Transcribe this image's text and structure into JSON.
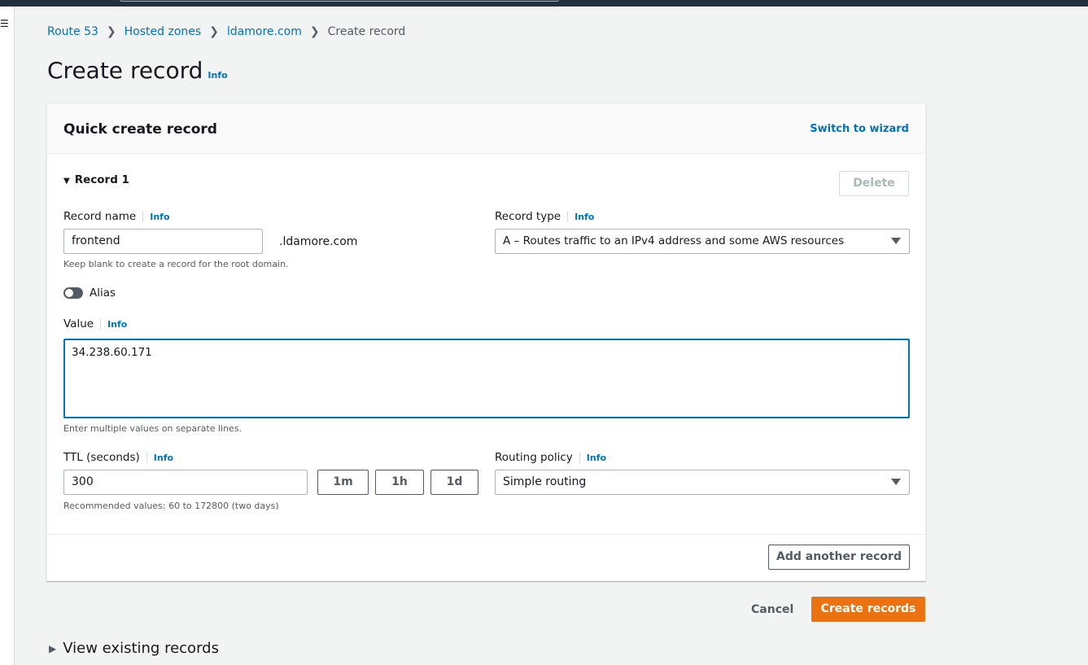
{
  "breadcrumb": [
    "Route 53",
    "Hosted zones",
    "ldamore.com",
    "Create record"
  ],
  "page": {
    "title": "Create record",
    "info": "Info"
  },
  "card": {
    "title": "Quick create record",
    "switch": "Switch to wizard"
  },
  "record": {
    "header": "Record 1",
    "delete": "Delete",
    "name_label": "Record name",
    "name_value": "frontend",
    "domain_suffix": ".ldamore.com",
    "name_hint": "Keep blank to create a record for the root domain.",
    "type_label": "Record type",
    "type_value": "A – Routes traffic to an IPv4 address and some AWS resources",
    "alias_label": "Alias",
    "alias_on": false,
    "value_label": "Value",
    "value": "34.238.60.171",
    "value_hint": "Enter multiple values on separate lines.",
    "ttl_label": "TTL (seconds)",
    "ttl_value": "300",
    "ttl_buttons": [
      "1m",
      "1h",
      "1d"
    ],
    "ttl_hint": "Recommended values: 60 to 172800 (two days)",
    "routing_label": "Routing policy",
    "routing_value": "Simple routing",
    "info": "Info"
  },
  "add_another": "Add another record",
  "actions": {
    "cancel": "Cancel",
    "create": "Create records"
  },
  "existing": {
    "title": "View existing records"
  },
  "colors": {
    "link": "#0073bb",
    "primary": "#ec7211",
    "focus": "#0073bb"
  }
}
